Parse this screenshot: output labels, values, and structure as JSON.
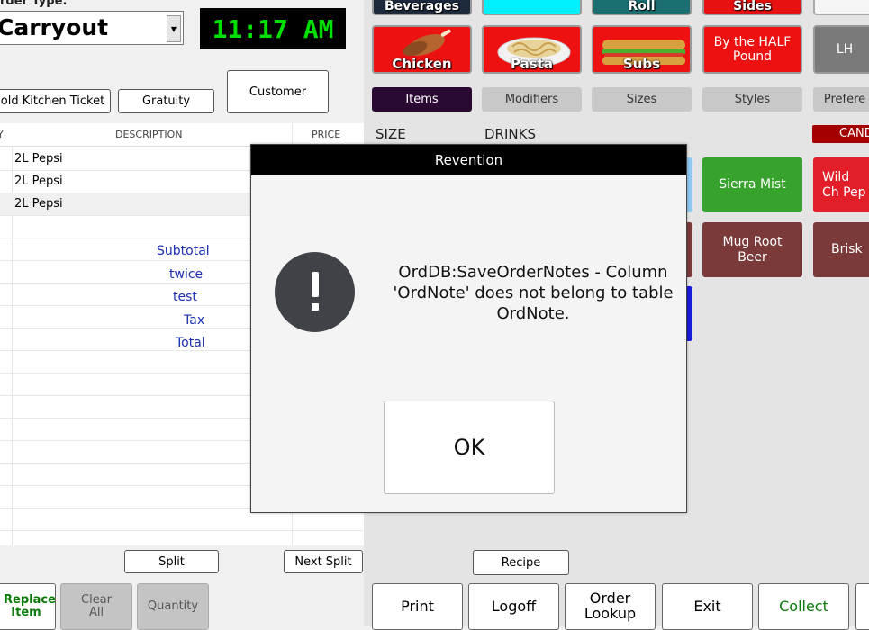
{
  "header": {
    "order_type_label": "rder Type:",
    "order_type_value": "Carryout",
    "clock": "11:17 AM",
    "buttons": [
      "old Kitchen Ticket",
      "Gratuity",
      "Customer"
    ]
  },
  "ticket": {
    "columns": [
      "Y",
      "DESCRIPTION",
      "PRICE"
    ],
    "items": [
      "2L Pepsi",
      "2L Pepsi",
      "2L Pepsi"
    ],
    "summary": [
      "Subtotal",
      "twice",
      "test",
      "Tax",
      "Total"
    ],
    "split_button": "Split",
    "next_split_button": "Next Split"
  },
  "left_bottom": {
    "replace_item": "Replace Item",
    "clear_all": "Clear All",
    "quantity": "Quantity"
  },
  "categories": {
    "top_row": [
      "Beverages",
      "",
      "Roll",
      "Sides",
      ""
    ],
    "second_row": [
      "Chicken",
      "Pasta",
      "Subs",
      "By the HALF Pound",
      "LH"
    ]
  },
  "tabs": [
    "Items",
    "Modifiers",
    "Sizes",
    "Styles",
    "Prefere"
  ],
  "menu": {
    "size_label": "SIZE",
    "drinks_label": "DRINKS",
    "cand_label": "CAND",
    "items": [
      "Sierra Mist",
      "Wild Ch Pep",
      "Mug Root Beer",
      "Brisk"
    ]
  },
  "recipe_button": "Recipe",
  "bottom_bar": [
    "Print",
    "Logoff",
    "Order Lookup",
    "Exit",
    "Collect"
  ],
  "dialog": {
    "title": "Revention",
    "message": "OrdDB:SaveOrderNotes - Column 'OrdNote' does not belong to table OrdNote.",
    "ok": "OK"
  },
  "colors": {
    "clock_bg": "#000000",
    "clock_text": "#00e000",
    "category_red": "#ee1111",
    "tab_active": "#2a0a33",
    "green_item": "#37a32d",
    "brown_item": "#7a3a3a",
    "summary_blue": "#1a2fb0"
  }
}
